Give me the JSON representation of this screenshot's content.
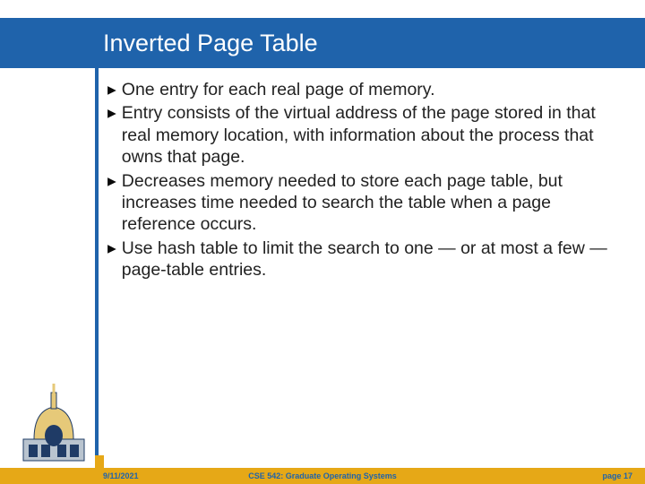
{
  "slide": {
    "title": "Inverted Page Table",
    "bullets": [
      "One entry for each real page of memory.",
      "Entry consists of the virtual address of the page stored in that real memory location, with information about the process that owns that page.",
      "Decreases memory needed to store each page table, but increases time needed to search the table when a page reference occurs.",
      "Use hash table to limit the search to one — or at most a few — page-table entries."
    ]
  },
  "footer": {
    "date": "9/11/2021",
    "course": "CSE 542: Graduate Operating Systems",
    "page": "page 17"
  },
  "colors": {
    "header_blue": "#1f63ab",
    "footer_gold": "#e6a817"
  }
}
